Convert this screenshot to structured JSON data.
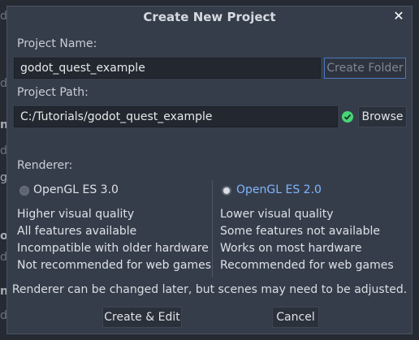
{
  "background_fragments": [
    "do",
    "do",
    "n",
    "do",
    "g",
    "ou",
    "do",
    "de",
    "ng",
    "de",
    "do",
    "g",
    "n",
    "do",
    "d"
  ],
  "dialog": {
    "title": "Create New Project",
    "close_icon": "close-icon",
    "project_name_label": "Project Name:",
    "project_name_value": "godot_quest_example",
    "create_folder_label": "Create Folder",
    "project_path_label": "Project Path:",
    "project_path_value": "C:/Tutorials/godot_quest_example",
    "path_status_icon": "checkmark-circle-icon",
    "path_status_color": "#45d675",
    "browse_label": "Browse",
    "renderer_label": "Renderer:",
    "renderers": [
      {
        "label": "OpenGL ES 3.0",
        "selected": false,
        "features": [
          "Higher visual quality",
          "All features available",
          "Incompatible with older hardware",
          "Not recommended for web games"
        ]
      },
      {
        "label": "OpenGL ES 2.0",
        "selected": true,
        "features": [
          "Lower visual quality",
          "Some features not available",
          "Works on most hardware",
          "Recommended for web games"
        ]
      }
    ],
    "selected_color": "#7fb5ff",
    "renderer_note": "Renderer can be changed later, but scenes may need to be adjusted.",
    "create_edit_label": "Create & Edit",
    "cancel_label": "Cancel"
  }
}
